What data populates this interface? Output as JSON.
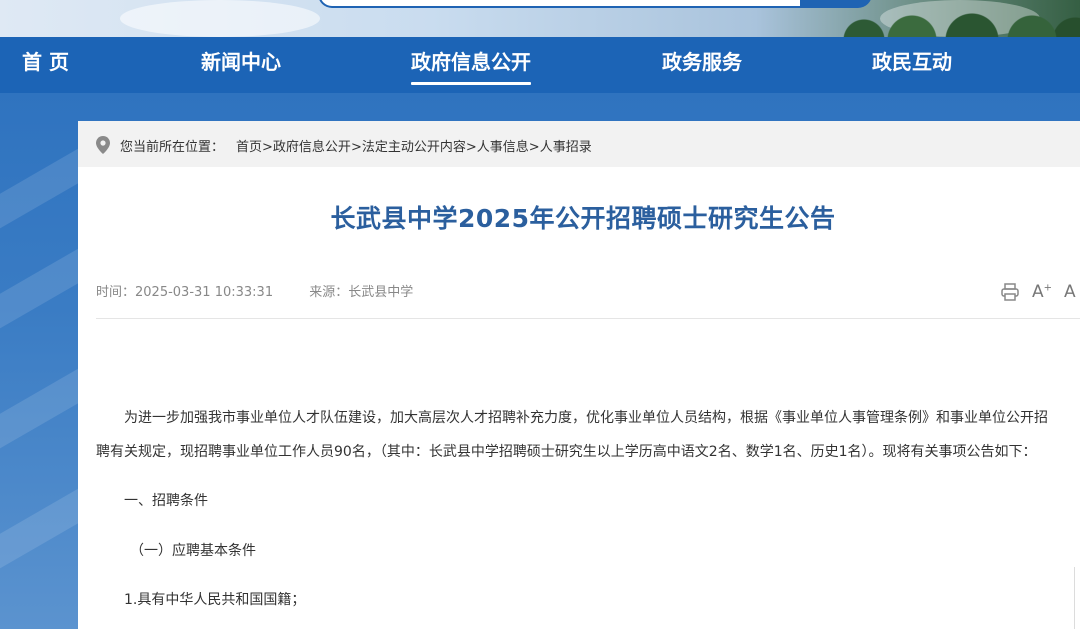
{
  "nav": {
    "items": [
      {
        "label": "首 页"
      },
      {
        "label": "新闻中心"
      },
      {
        "label": "政府信息公开"
      },
      {
        "label": "政务服务"
      },
      {
        "label": "政民互动"
      }
    ],
    "active_index": 2
  },
  "breadcrumb": {
    "prefix": "您当前所在位置：",
    "items": [
      "首页",
      "政府信息公开",
      "法定主动公开内容",
      "人事信息",
      "人事招录"
    ],
    "separator": ">"
  },
  "article": {
    "title": "长武县中学2025年公开招聘硕士研究生公告",
    "time_label": "时间：",
    "time_value": "2025-03-31 10:33:31",
    "source_label": "来源：",
    "source_value": "长武县中学",
    "paragraphs": [
      "为进一步加强我市事业单位人才队伍建设，加大高层次人才招聘补充力度，优化事业单位人员结构，根据《事业单位人事管理条例》和事业单位公开招",
      "聘有关规定，现招聘事业单位工作人员90名，（其中：长武县中学招聘硕士研究生以上学历高中语文2名、数学1名、历史1名）。现将有关事项公告如下：",
      "一、招聘条件",
      "（一）应聘基本条件",
      "1.具有中华人民共和国国籍；"
    ]
  },
  "tools": {
    "font_up": "A",
    "font_up_sup": "+",
    "font_down": "A"
  },
  "colors": {
    "nav_bg": "#1c64b6",
    "title": "#2b5f9e",
    "breadcrumb_bg": "#f2f2f2"
  }
}
